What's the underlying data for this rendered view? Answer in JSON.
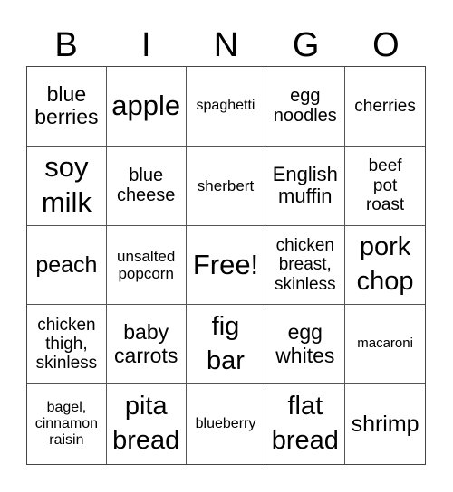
{
  "header": [
    "B",
    "I",
    "N",
    "G",
    "O"
  ],
  "cells": [
    {
      "text": "blue\nberries"
    },
    {
      "text": "apple"
    },
    {
      "text": "spaghetti"
    },
    {
      "text": "egg\nnoodles"
    },
    {
      "text": "cherries"
    },
    {
      "text": "soy\nmilk"
    },
    {
      "text": "blue\ncheese"
    },
    {
      "text": "sherbert"
    },
    {
      "text": "English\nmuffin"
    },
    {
      "text": "beef\npot\nroast"
    },
    {
      "text": "peach"
    },
    {
      "text": "unsalted\npopcorn"
    },
    {
      "text": "Free!"
    },
    {
      "text": "chicken\nbreast,\nskinless"
    },
    {
      "text": "pork\nchop"
    },
    {
      "text": "chicken\nthigh,\nskinless"
    },
    {
      "text": "baby\ncarrots"
    },
    {
      "text": "fig\nbar"
    },
    {
      "text": "egg\nwhites"
    },
    {
      "text": "macaroni"
    },
    {
      "text": "bagel,\ncinnamon\nraisin"
    },
    {
      "text": "pita\nbread"
    },
    {
      "text": "blueberry"
    },
    {
      "text": "flat\nbread"
    },
    {
      "text": "shrimp"
    }
  ]
}
